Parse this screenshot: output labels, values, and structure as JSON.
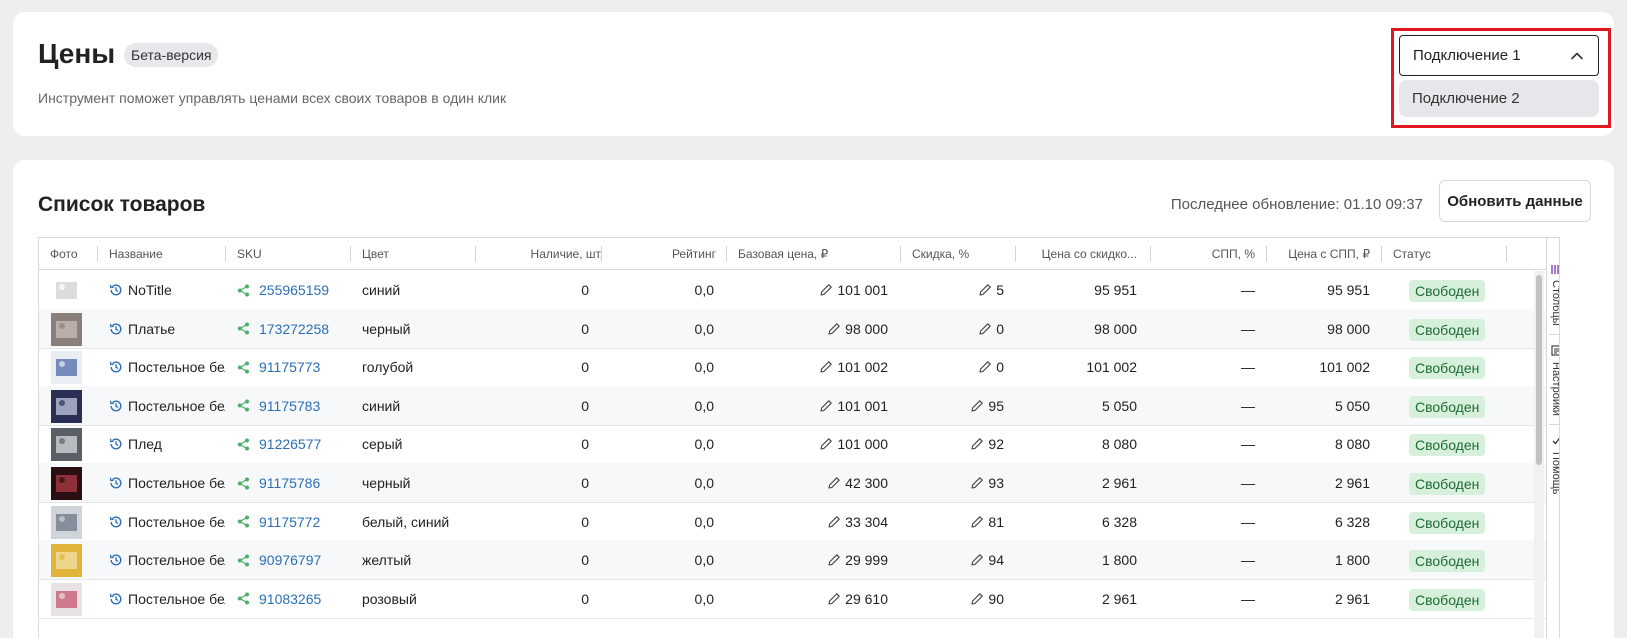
{
  "header": {
    "title": "Цены",
    "badge": "Бета-версия",
    "subtitle": "Инструмент поможет управлять ценами всех своих товаров в один клик"
  },
  "connection_select": {
    "value": "Подключение 1",
    "options": [
      "Подключение 2"
    ]
  },
  "products": {
    "title": "Список товаров",
    "last_update": "Последнее обновление: 01.10 09:37",
    "refresh_label": "Обновить данные",
    "columns": [
      "Фото",
      "Название",
      "SKU",
      "Цвет",
      "Наличие, шт.",
      "Рейтинг",
      "Базовая цена, ₽",
      "Скидка, %",
      "Цена со скидко...",
      "СПП, %",
      "Цена с СПП, ₽",
      "Статус"
    ],
    "rows": [
      {
        "name": "NoTitle",
        "sku": "255965159",
        "color": "синий",
        "stock": "0",
        "rating": "0,0",
        "base_price": "101 001",
        "discount": "5",
        "discount_price": "95 951",
        "spp": "—",
        "spp_price": "95 951",
        "status": "Свободен"
      },
      {
        "name": "Платье",
        "sku": "173272258",
        "color": "черный",
        "stock": "0",
        "rating": "0,0",
        "base_price": "98 000",
        "discount": "0",
        "discount_price": "98 000",
        "spp": "—",
        "spp_price": "98 000",
        "status": "Свободен"
      },
      {
        "name": "Постельное бел",
        "sku": "91175773",
        "color": "голубой",
        "stock": "0",
        "rating": "0,0",
        "base_price": "101 002",
        "discount": "0",
        "discount_price": "101 002",
        "spp": "—",
        "spp_price": "101 002",
        "status": "Свободен"
      },
      {
        "name": "Постельное бел",
        "sku": "91175783",
        "color": "синий",
        "stock": "0",
        "rating": "0,0",
        "base_price": "101 001",
        "discount": "95",
        "discount_price": "5 050",
        "spp": "—",
        "spp_price": "5 050",
        "status": "Свободен"
      },
      {
        "name": "Плед",
        "sku": "91226577",
        "color": "серый",
        "stock": "0",
        "rating": "0,0",
        "base_price": "101 000",
        "discount": "92",
        "discount_price": "8 080",
        "spp": "—",
        "spp_price": "8 080",
        "status": "Свободен"
      },
      {
        "name": "Постельное бел",
        "sku": "91175786",
        "color": "черный",
        "stock": "0",
        "rating": "0,0",
        "base_price": "42 300",
        "discount": "93",
        "discount_price": "2 961",
        "spp": "—",
        "spp_price": "2 961",
        "status": "Свободен"
      },
      {
        "name": "Постельное бел",
        "sku": "91175772",
        "color": "белый, синий",
        "stock": "0",
        "rating": "0,0",
        "base_price": "33 304",
        "discount": "81",
        "discount_price": "6 328",
        "spp": "—",
        "spp_price": "6 328",
        "status": "Свободен"
      },
      {
        "name": "Постельное бел",
        "sku": "90976797",
        "color": "желтый",
        "stock": "0",
        "rating": "0,0",
        "base_price": "29 999",
        "discount": "94",
        "discount_price": "1 800",
        "spp": "—",
        "spp_price": "1 800",
        "status": "Свободен"
      },
      {
        "name": "Постельное бел",
        "sku": "91083265",
        "color": "розовый",
        "stock": "0",
        "rating": "0,0",
        "base_price": "29 610",
        "discount": "90",
        "discount_price": "2 961",
        "spp": "—",
        "spp_price": "2 961",
        "status": "Свободен"
      }
    ]
  },
  "side_panel": {
    "columns_label": "Столбцы",
    "settings_label": "Настройки",
    "help_label": "Помощь"
  },
  "colors": {
    "accent_link": "#2b6fb6",
    "status_bg": "#d7f0dc",
    "status_text": "#1e6b34",
    "highlight": "#e0171f",
    "share_icon": "#4caf6a"
  }
}
